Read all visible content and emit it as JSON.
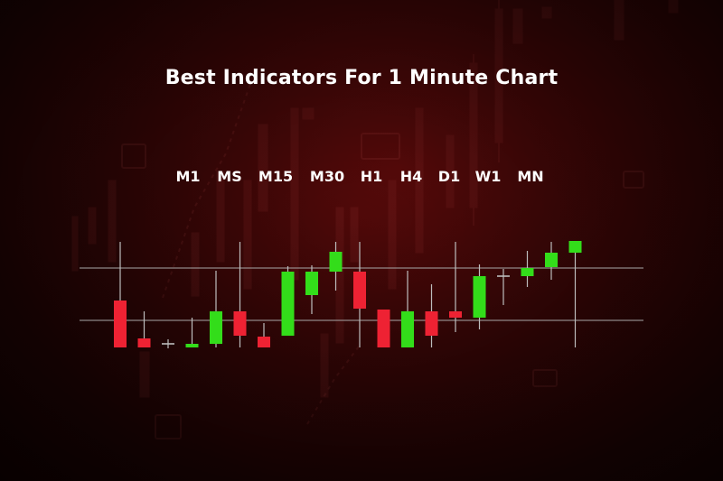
{
  "title": "Best Indicators For 1 Minute Chart",
  "timeframes": [
    "M1",
    "MS",
    "M15",
    "M30",
    "H1",
    "H4",
    "D1",
    "W1",
    "MN"
  ],
  "colors": {
    "bullish": "#33dd1a",
    "bearish": "#ee2233",
    "neutral": "#bdbdbd",
    "guide_line": "#a8a8a8",
    "title": "#ffffff"
  },
  "chart_data": {
    "type": "candlestick",
    "grid": false,
    "legend": "none",
    "guide_levels": [
      297,
      355
    ],
    "candles": [
      {
        "dir": "bear",
        "open": 333,
        "close": 385,
        "high": 268,
        "low": 385
      },
      {
        "dir": "bear",
        "open": 375,
        "close": 385,
        "high": 345,
        "low": 385
      },
      {
        "dir": "neutral",
        "open": 381,
        "close": 381,
        "high": 376,
        "low": 386
      },
      {
        "dir": "bull",
        "open": 385,
        "close": 381,
        "high": 352,
        "low": 385
      },
      {
        "dir": "bull",
        "open": 381,
        "close": 345,
        "high": 300,
        "low": 385
      },
      {
        "dir": "bear",
        "open": 345,
        "close": 372,
        "high": 268,
        "low": 385
      },
      {
        "dir": "bear",
        "open": 373,
        "close": 385,
        "high": 358,
        "low": 385
      },
      {
        "dir": "bull",
        "open": 372,
        "close": 301,
        "high": 295,
        "low": 372
      },
      {
        "dir": "bull",
        "open": 327,
        "close": 301,
        "high": 294,
        "low": 348
      },
      {
        "dir": "bull",
        "open": 301,
        "close": 279,
        "high": 268,
        "low": 322
      },
      {
        "dir": "bear",
        "open": 301,
        "close": 342,
        "high": 268,
        "low": 385
      },
      {
        "dir": "bear",
        "open": 343,
        "close": 385,
        "high": 343,
        "low": 385
      },
      {
        "dir": "bull",
        "open": 385,
        "close": 345,
        "high": 300,
        "low": 385
      },
      {
        "dir": "bear",
        "open": 345,
        "close": 372,
        "high": 315,
        "low": 385
      },
      {
        "dir": "bear",
        "open": 345,
        "close": 352,
        "high": 268,
        "low": 368
      },
      {
        "dir": "bull",
        "open": 352,
        "close": 306,
        "high": 293,
        "low": 365
      },
      {
        "dir": "neutral",
        "open": 306,
        "close": 306,
        "high": 298,
        "low": 338
      },
      {
        "dir": "bull",
        "open": 306,
        "close": 297,
        "high": 278,
        "low": 318
      },
      {
        "dir": "bull",
        "open": 296,
        "close": 280,
        "high": 268,
        "low": 310
      },
      {
        "dir": "bull",
        "open": 280,
        "close": 267,
        "high": 267,
        "low": 385
      }
    ]
  }
}
